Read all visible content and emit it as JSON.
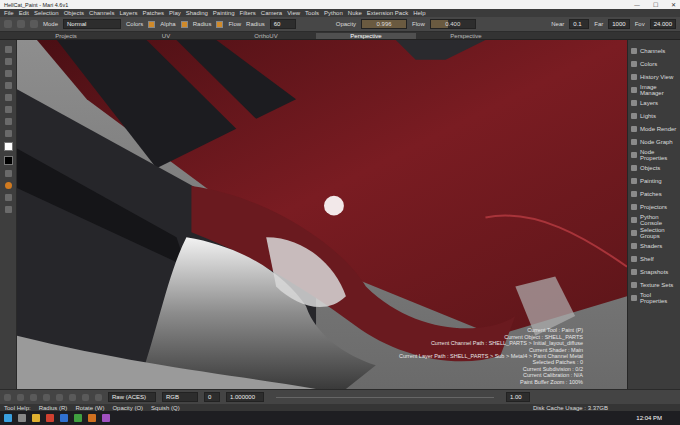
{
  "window": {
    "title": "HellCat_Paint - Mari 4.6v1",
    "controls": [
      "—",
      "☐",
      "✕"
    ]
  },
  "menu": [
    "File",
    "Edit",
    "Selection",
    "Objects",
    "Channels",
    "Layers",
    "Patches",
    "Play",
    "Shading",
    "Painting",
    "Filters",
    "Camera",
    "View",
    "Tools",
    "Python",
    "Nuke",
    "Extension Pack",
    "Help"
  ],
  "toolbar": {
    "mode_label": "Mode",
    "mode_value": "Normal",
    "colors_label": "Colors",
    "toggles": [
      {
        "label": "Alpha",
        "checked": true
      },
      {
        "label": "Radius",
        "checked": true
      },
      {
        "label": "Flow",
        "checked": true
      }
    ],
    "radius_label": "Radius",
    "radius_value": "60",
    "opacity_label": "Opacity",
    "opacity_value": "0.996",
    "opacity_level": 0.996,
    "flow_label": "Flow",
    "flow_value": "0.400",
    "flow_level": 0.4,
    "camera": [
      {
        "label": "Near",
        "value": "0.1"
      },
      {
        "label": "Far",
        "value": "1000"
      },
      {
        "label": "Fov",
        "value": "24.000"
      }
    ]
  },
  "view_tabs": [
    {
      "label": "Projects",
      "selected": false
    },
    {
      "label": "UV",
      "selected": false
    },
    {
      "label": "OrthoUV",
      "selected": false
    },
    {
      "label": "Perspective",
      "selected": true
    },
    {
      "label": "Perspective",
      "selected": false
    }
  ],
  "swatches": [
    {
      "color": "#ffffff"
    },
    {
      "color": "#000000"
    }
  ],
  "palettes": [
    "Channels",
    "Colors",
    "History View",
    "Image Manager",
    "Layers",
    "Lights",
    "Mode Render",
    "Node Graph",
    "Node Properties",
    "Objects",
    "Painting",
    "Patches",
    "Projectors",
    "Python Console",
    "Selection Groups",
    "Shaders",
    "Shelf",
    "Snapshots",
    "Texture Sets",
    "Tool Properties"
  ],
  "overlay_info": [
    "Current Tool : Paint (P)",
    "Current Object : SHELL_PARTS",
    "Current Channel Path : SHELL_PARTS > Initial_layout_diffuse",
    "Current Shader : Main",
    "Current Layer Path : SHELL_PARTS > Sub > Metal4 > Paint Channel Metal",
    "Selected Patches : 0",
    "Current Subdivision : 0/2",
    "Current Calibration : N/A",
    "Paint Buffer Zoom : 100%"
  ],
  "bottom_toolbar": {
    "colorspace": "Raw (ACES)",
    "channel": "RGB",
    "gamma": "0",
    "gain": "1.000000",
    "exposure": "1.00"
  },
  "status_bar": {
    "help": "Tool Help:",
    "hints": [
      "Radius (R)",
      "Rotate (W)",
      "Opacity (O)",
      "Squish (Q)"
    ],
    "disk": "Disk Cache Usage : 3.37GB"
  },
  "taskbar": {
    "time": "12:04 PM"
  }
}
